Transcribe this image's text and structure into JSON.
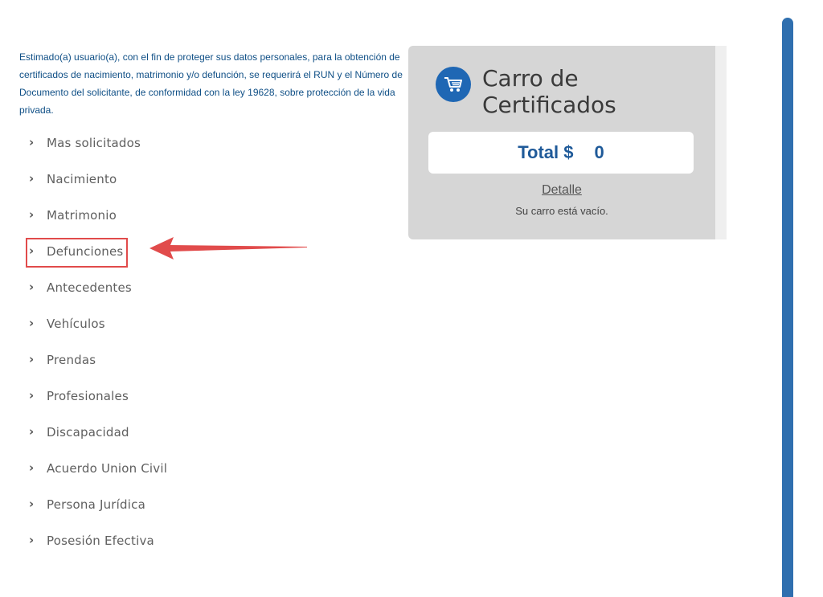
{
  "notice": {
    "text": "Estimado(a) usuario(a), con el fin de proteger sus datos personales, para la obtención de certificados de nacimiento, matrimonio y/o defunción, se requerirá el RUN y el Número de Documento del solicitante, de conformidad con la ley 19628, sobre protección de la vida privada."
  },
  "menu": {
    "items": [
      {
        "label": "Mas solicitados"
      },
      {
        "label": "Nacimiento"
      },
      {
        "label": "Matrimonio"
      },
      {
        "label": "Defunciones"
      },
      {
        "label": "Antecedentes"
      },
      {
        "label": "Vehículos"
      },
      {
        "label": "Prendas"
      },
      {
        "label": "Profesionales"
      },
      {
        "label": "Discapacidad"
      },
      {
        "label": "Acuerdo Union Civil"
      },
      {
        "label": "Persona Jurídica"
      },
      {
        "label": "Posesión Efectiva"
      }
    ]
  },
  "cart": {
    "title": "Carro de Certificados",
    "total_label": "Total $",
    "total_value": "0",
    "detail_link": "Detalle",
    "empty_text": "Su carro está vacío."
  },
  "icons": {
    "chevron": "chevron-right-icon",
    "cart": "shopping-cart-icon"
  },
  "colors": {
    "notice_text": "#0f4f86",
    "accent_blue": "#1f67b4",
    "highlight_red": "#e14b4b",
    "cart_bg": "#d6d6d6",
    "scrollbar": "#2f6faf"
  }
}
